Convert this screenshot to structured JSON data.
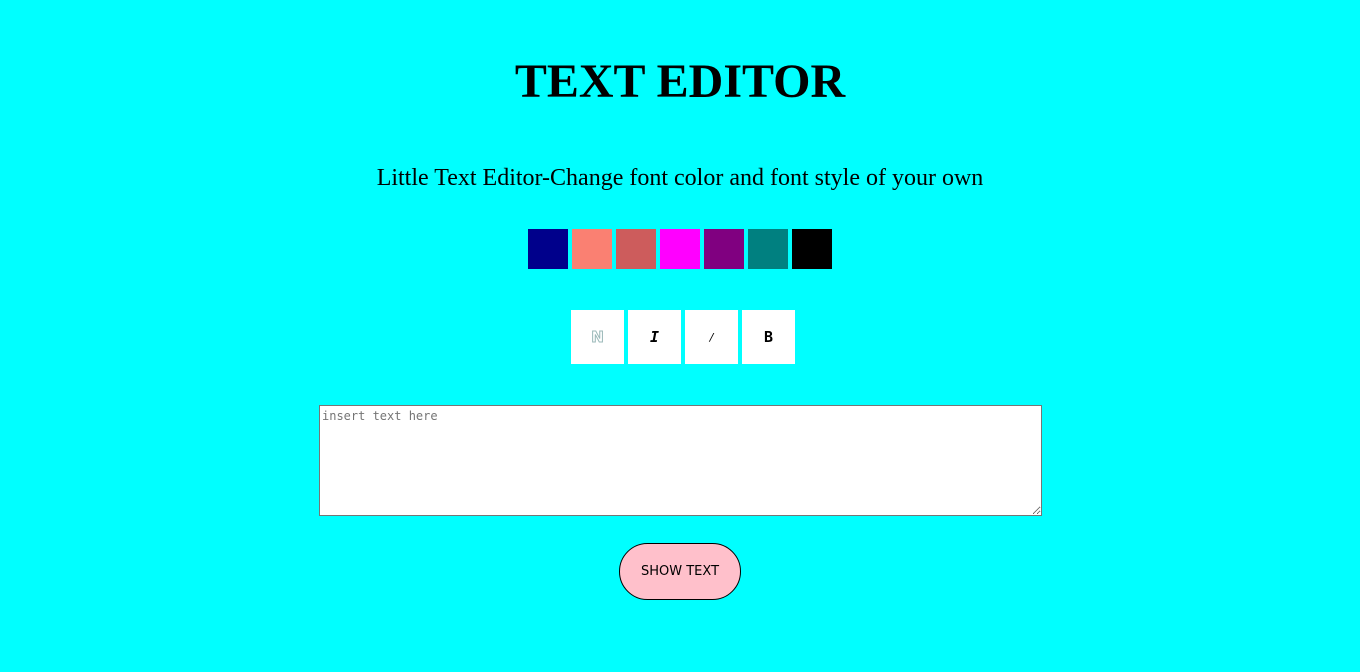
{
  "page": {
    "title": "TEXT EDITOR",
    "subtitle": "Little Text Editor-Change font color and font style of your own",
    "background_color": "#00ffff"
  },
  "color_swatches": [
    {
      "name": "navy",
      "color": "#00008b"
    },
    {
      "name": "salmon",
      "color": "#fa8072"
    },
    {
      "name": "indianred",
      "color": "#cd5c5c"
    },
    {
      "name": "magenta",
      "color": "#ff00ff"
    },
    {
      "name": "purple",
      "color": "#800080"
    },
    {
      "name": "teal",
      "color": "#008080"
    },
    {
      "name": "black",
      "color": "#000000"
    }
  ],
  "style_buttons": [
    {
      "id": "normal",
      "label": "N"
    },
    {
      "id": "italic",
      "label": "I"
    },
    {
      "id": "oblique",
      "label": "/"
    },
    {
      "id": "bold",
      "label": "B"
    }
  ],
  "editor": {
    "placeholder": "insert text here",
    "value": ""
  },
  "show_button": {
    "label": "SHOW TEXT",
    "background_color": "#ffc0cb"
  }
}
